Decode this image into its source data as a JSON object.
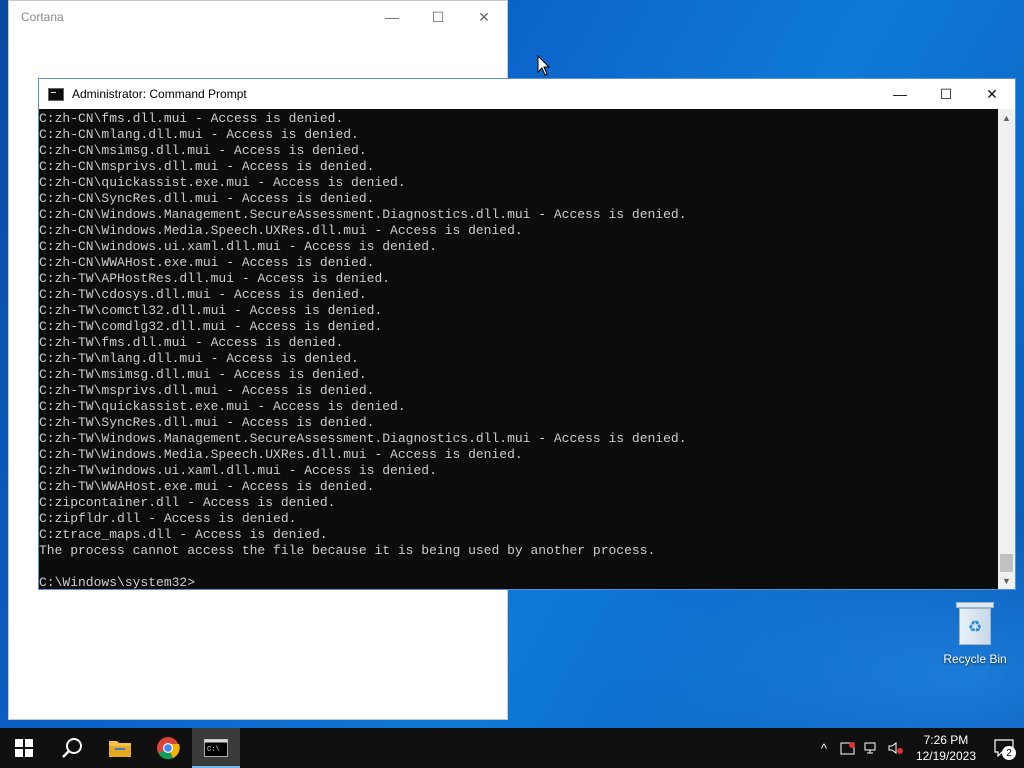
{
  "cortana": {
    "title": "Cortana",
    "minimize_glyph": "—",
    "maximize_glyph": "☐",
    "close_glyph": "✕"
  },
  "cmd": {
    "title": "Administrator: Command Prompt",
    "minimize_glyph": "—",
    "maximize_glyph": "☐",
    "close_glyph": "✕",
    "lines": [
      "C:zh-CN\\fms.dll.mui - Access is denied.",
      "C:zh-CN\\mlang.dll.mui - Access is denied.",
      "C:zh-CN\\msimsg.dll.mui - Access is denied.",
      "C:zh-CN\\msprivs.dll.mui - Access is denied.",
      "C:zh-CN\\quickassist.exe.mui - Access is denied.",
      "C:zh-CN\\SyncRes.dll.mui - Access is denied.",
      "C:zh-CN\\Windows.Management.SecureAssessment.Diagnostics.dll.mui - Access is denied.",
      "C:zh-CN\\Windows.Media.Speech.UXRes.dll.mui - Access is denied.",
      "C:zh-CN\\windows.ui.xaml.dll.mui - Access is denied.",
      "C:zh-CN\\WWAHost.exe.mui - Access is denied.",
      "C:zh-TW\\APHostRes.dll.mui - Access is denied.",
      "C:zh-TW\\cdosys.dll.mui - Access is denied.",
      "C:zh-TW\\comctl32.dll.mui - Access is denied.",
      "C:zh-TW\\comdlg32.dll.mui - Access is denied.",
      "C:zh-TW\\fms.dll.mui - Access is denied.",
      "C:zh-TW\\mlang.dll.mui - Access is denied.",
      "C:zh-TW\\msimsg.dll.mui - Access is denied.",
      "C:zh-TW\\msprivs.dll.mui - Access is denied.",
      "C:zh-TW\\quickassist.exe.mui - Access is denied.",
      "C:zh-TW\\SyncRes.dll.mui - Access is denied.",
      "C:zh-TW\\Windows.Management.SecureAssessment.Diagnostics.dll.mui - Access is denied.",
      "C:zh-TW\\Windows.Media.Speech.UXRes.dll.mui - Access is denied.",
      "C:zh-TW\\windows.ui.xaml.dll.mui - Access is denied.",
      "C:zh-TW\\WWAHost.exe.mui - Access is denied.",
      "C:zipcontainer.dll - Access is denied.",
      "C:zipfldr.dll - Access is denied.",
      "C:ztrace_maps.dll - Access is denied.",
      "The process cannot access the file because it is being used by another process.",
      "",
      "C:\\Windows\\system32>"
    ],
    "scroll_up_glyph": "▲",
    "scroll_down_glyph": "▼"
  },
  "desktop": {
    "recycle_bin_label": "Recycle Bin"
  },
  "taskbar": {
    "apps": [
      {
        "name": "start",
        "icon": "windows-logo-icon"
      },
      {
        "name": "search",
        "icon": "search-icon"
      },
      {
        "name": "file-explorer",
        "icon": "folder-icon"
      },
      {
        "name": "chrome",
        "icon": "chrome-icon"
      },
      {
        "name": "command-prompt",
        "icon": "cmd-icon",
        "active": true
      }
    ],
    "tray": {
      "overflow_glyph": "^",
      "time": "7:26 PM",
      "date": "12/19/2023",
      "notification_count": "2"
    }
  },
  "colors": {
    "console_bg": "#0c0c0c",
    "console_fg": "#cccccc",
    "taskbar_bg": "#101010",
    "accent": "#76b9ed"
  }
}
